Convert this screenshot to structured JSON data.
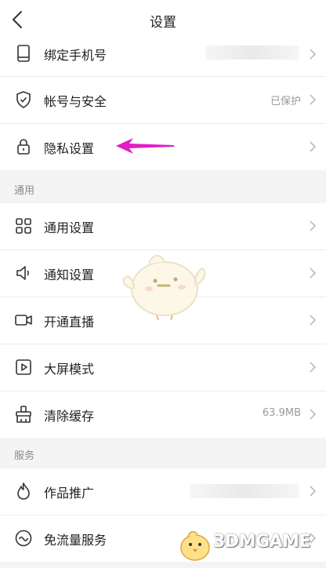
{
  "header": {
    "title": "设置"
  },
  "account": {
    "items": [
      {
        "label": "绑定手机号",
        "value": ""
      },
      {
        "label": "帐号与安全",
        "value": "已保护"
      },
      {
        "label": "隐私设置",
        "value": ""
      }
    ]
  },
  "general": {
    "section_title": "通用",
    "items": [
      {
        "label": "通用设置",
        "value": ""
      },
      {
        "label": "通知设置",
        "value": ""
      },
      {
        "label": "开通直播",
        "value": ""
      },
      {
        "label": "大屏模式",
        "value": ""
      },
      {
        "label": "清除缓存",
        "value": "63.9MB"
      }
    ]
  },
  "services": {
    "section_title": "服务",
    "items": [
      {
        "label": "作品推广",
        "value": ""
      },
      {
        "label": "免流量服务",
        "value": ""
      }
    ]
  },
  "annotation": {
    "arrow_color": "#e01ec6"
  },
  "watermark": {
    "text": "3DMGAME"
  }
}
